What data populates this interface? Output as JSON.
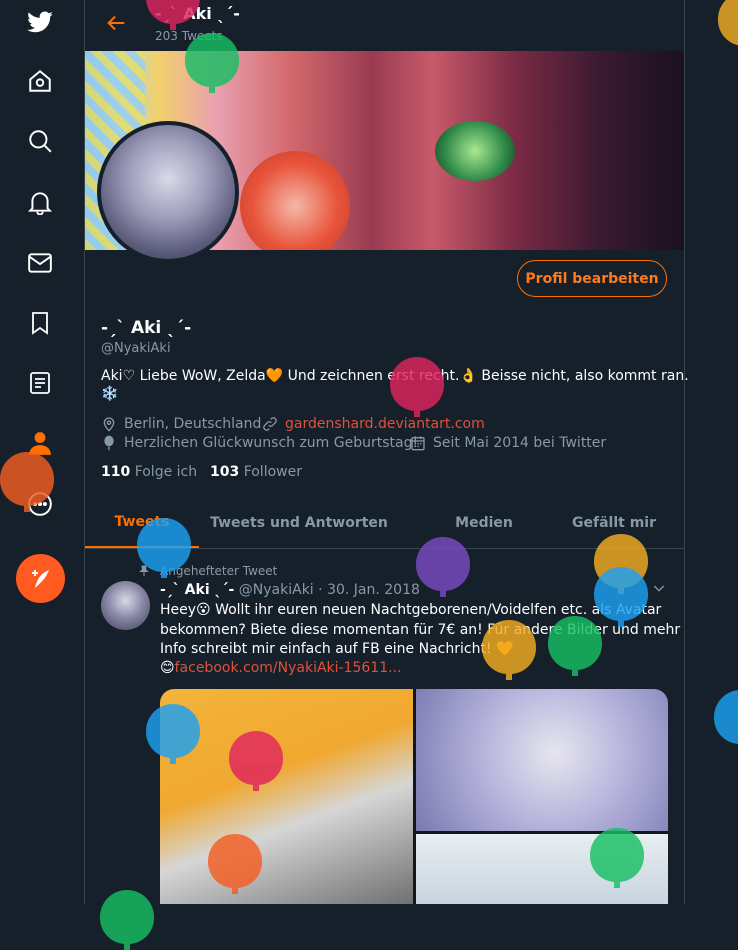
{
  "nav": {
    "items": [
      "twitter-logo",
      "home",
      "explore",
      "notifications",
      "messages",
      "bookmarks",
      "lists",
      "profile",
      "more"
    ],
    "compose_label": "Tweet"
  },
  "header": {
    "display_name": "-ˏˋ Aki ˎˊ-",
    "tweet_count": "203 Tweets"
  },
  "profile": {
    "display_name": "-ˏˋ Aki ˎˊ-",
    "handle": "@NyakiAki",
    "edit_button": "Profil bearbeiten",
    "bio_line1": "Aki♡ Liebe WoW, Zelda🧡 Und zeichnen erst recht.👌 Beisse nicht, also kommt ran.",
    "bio_line2": "❄️",
    "location": "Berlin, Deutschland",
    "website": "gardenshard.deviantart.com",
    "birthday": "Herzlichen Glückwunsch zum Geburtstag!",
    "joined": "Seit Mai 2014 bei Twitter",
    "following_count": "110",
    "following_label": "Folge ich",
    "followers_count": "103",
    "followers_label": "Follower"
  },
  "tabs": [
    {
      "label": "Tweets",
      "active": true
    },
    {
      "label": "Tweets und Antworten",
      "active": false
    },
    {
      "label": "Medien",
      "active": false
    },
    {
      "label": "Gefällt mir",
      "active": false
    }
  ],
  "pinned_tweet": {
    "pinned_label": "Angehefteter Tweet",
    "author_name": "-ˏˋ Aki ˎˊ-",
    "author_handle": "@NyakiAki",
    "separator": "·",
    "date": "30. Jan. 2018",
    "line1": "Heey😮 Wollt ihr euren neuen Nachtgeborenen/Voidelfen etc. als Avatar",
    "line2": "bekommen? Biete diese momentan für 7€ an! Für andere Bilder und mehr",
    "line3": "Info schreibt mir einfach auf FB eine Nachricht! 🧡",
    "link_emoji": "😊",
    "link": "facebook.com/NyakiAki-15611..."
  },
  "colors": {
    "accent": "#ff6f00",
    "background": "#15202b",
    "muted": "#8899a6",
    "link": "#e0513a"
  }
}
